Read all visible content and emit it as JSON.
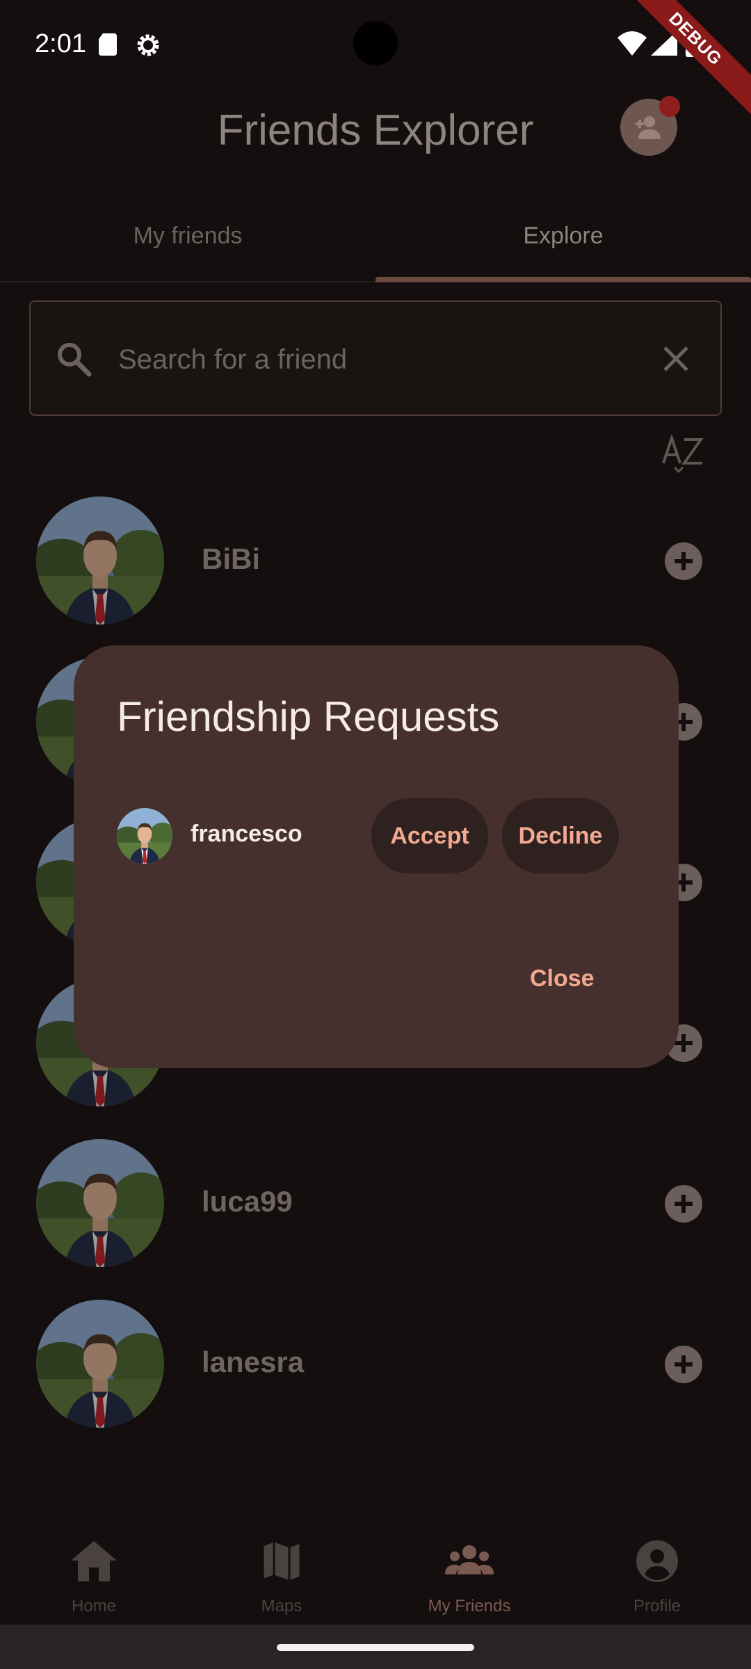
{
  "status_bar": {
    "time": "2:01",
    "debug": "DEBUG"
  },
  "app_bar": {
    "title": "Friends Explorer"
  },
  "tabs": [
    {
      "label": "My friends"
    },
    {
      "label": "Explore"
    }
  ],
  "search": {
    "placeholder": "Search for a friend",
    "value": ""
  },
  "friends": [
    {
      "name": "BiBi"
    },
    {
      "name": ""
    },
    {
      "name": ""
    },
    {
      "name": ""
    },
    {
      "name": "luca99"
    },
    {
      "name": "lanesra"
    }
  ],
  "dialog": {
    "title": "Friendship Requests",
    "requests": [
      {
        "name": "francesco",
        "accept_label": "Accept",
        "decline_label": "Decline"
      }
    ],
    "close_label": "Close"
  },
  "bottom_nav": [
    {
      "label": "Home",
      "icon": "home-icon"
    },
    {
      "label": "Maps",
      "icon": "map-icon"
    },
    {
      "label": "My Friends",
      "icon": "group-icon",
      "active": true
    },
    {
      "label": "Profile",
      "icon": "account-circle-icon"
    }
  ],
  "colors": {
    "accent": "#f2a98f",
    "dialog_bg": "#46302d",
    "background": "#140e0e"
  }
}
